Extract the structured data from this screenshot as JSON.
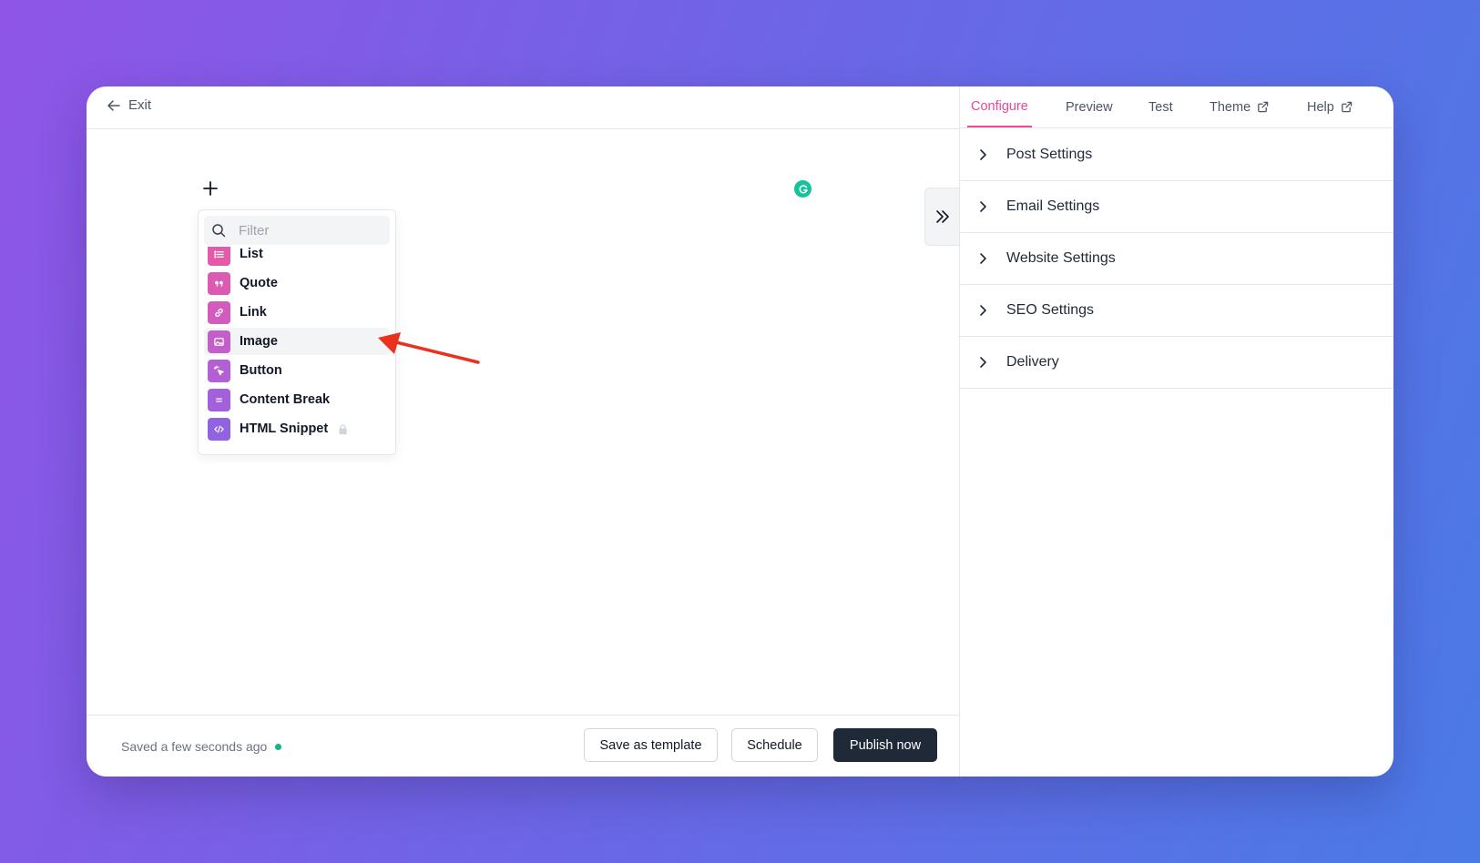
{
  "editor": {
    "exit_label": "Exit",
    "filter_placeholder": "Filter",
    "block_items": [
      {
        "label": "List",
        "color": "#e35aa8"
      },
      {
        "label": "Quote",
        "color": "#db5bb3"
      },
      {
        "label": "Link",
        "color": "#d25cbd"
      },
      {
        "label": "Image",
        "color": "#c35fc9"
      },
      {
        "label": "Button",
        "color": "#b260d3"
      },
      {
        "label": "Content Break",
        "color": "#a261da"
      },
      {
        "label": "HTML Snippet",
        "color": "#9263e0"
      }
    ],
    "save_status": "Saved a few seconds ago",
    "buttons": {
      "save_template": "Save as template",
      "schedule": "Schedule",
      "publish": "Publish now"
    }
  },
  "settings": {
    "tabs": [
      {
        "label": "Configure"
      },
      {
        "label": "Preview"
      },
      {
        "label": "Test"
      },
      {
        "label": "Theme"
      },
      {
        "label": "Help"
      }
    ],
    "sections": [
      {
        "label": "Post Settings"
      },
      {
        "label": "Email Settings"
      },
      {
        "label": "Website Settings"
      },
      {
        "label": "SEO Settings"
      },
      {
        "label": "Delivery"
      }
    ]
  },
  "colors": {
    "accent": "#ec4899",
    "primary_button": "#1f2937",
    "status_dot": "#10b981",
    "annotation_arrow": "#e8321e"
  }
}
